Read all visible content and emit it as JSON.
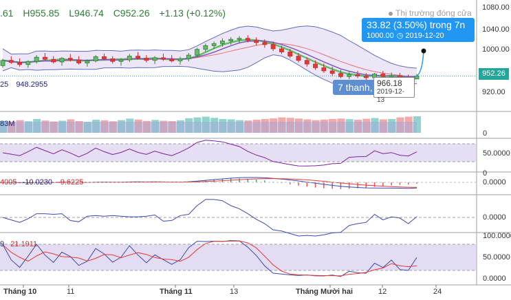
{
  "ohlc": {
    "open": ".61",
    "high": "H955.85",
    "low": "L946.74",
    "close": "C952.26",
    "change": "+1.13 (+0.12%)"
  },
  "market_status": "Thị trường đóng cửa",
  "bb_values": {
    "a": "25",
    "b": "948.2955"
  },
  "volume_value": "83M",
  "macd_values": {
    "a": "4005",
    "b": "-10.0230",
    "c": "-9.6225"
  },
  "stoch_values": {
    "a": "9",
    "b": "21.1911"
  },
  "measure": {
    "change": "33.82 (3.50%) trong 7n",
    "price": "1000.00",
    "date": "2019-12-20"
  },
  "low_label": {
    "text": "7 thanh,",
    "value": "966.18",
    "date": "2019-12-13"
  },
  "current_price": "952.26",
  "price_axis": [
    "1080.00",
    "1040.00",
    "1000.00",
    "920.00"
  ],
  "volume_axis": "0",
  "rsi_axis": [
    "50.0000",
    "0"
  ],
  "macd_axis": "0.0000",
  "mom_axis": "0.0000",
  "stoch_axis": [
    "100.0000",
    "50.0000",
    "0.0000"
  ],
  "x_axis": [
    {
      "label": "Tháng 10",
      "bold": true
    },
    {
      "label": "11",
      "bold": false
    },
    {
      "label": "Tháng 11",
      "bold": true
    },
    {
      "label": "13",
      "bold": false
    },
    {
      "label": "Tháng Mười hai",
      "bold": true
    },
    {
      "label": "12",
      "bold": false
    },
    {
      "label": "24",
      "bold": false
    }
  ],
  "colors": {
    "up": "#26a69a",
    "down": "#ef5350",
    "accent": "#2196f3",
    "band": "#7e57c2"
  },
  "chart_data": {
    "type": "candlestick",
    "ohlc_series": [
      [
        972,
        985,
        968,
        982
      ],
      [
        982,
        990,
        975,
        978
      ],
      [
        978,
        986,
        970,
        974
      ],
      [
        974,
        982,
        968,
        980
      ],
      [
        980,
        992,
        976,
        988
      ],
      [
        988,
        996,
        982,
        984
      ],
      [
        984,
        990,
        976,
        979
      ],
      [
        979,
        988,
        972,
        986
      ],
      [
        986,
        994,
        980,
        983
      ],
      [
        983,
        990,
        974,
        977
      ],
      [
        977,
        984,
        970,
        981
      ],
      [
        981,
        992,
        978,
        989
      ],
      [
        989,
        995,
        982,
        985
      ],
      [
        985,
        990,
        976,
        980
      ],
      [
        980,
        986,
        972,
        983
      ],
      [
        983,
        994,
        979,
        990
      ],
      [
        990,
        998,
        984,
        986
      ],
      [
        986,
        992,
        978,
        982
      ],
      [
        982,
        990,
        975,
        987
      ],
      [
        987,
        995,
        981,
        984
      ],
      [
        984,
        992,
        978,
        981
      ],
      [
        981,
        989,
        974,
        985
      ],
      [
        985,
        996,
        980,
        992
      ],
      [
        992,
        1006,
        988,
        1003
      ],
      [
        1003,
        1014,
        998,
        1010
      ],
      [
        1010,
        1018,
        1004,
        1014
      ],
      [
        1014,
        1024,
        1008,
        1019
      ],
      [
        1019,
        1026,
        1012,
        1022
      ],
      [
        1022,
        1028,
        1014,
        1024
      ],
      [
        1024,
        1030,
        1016,
        1020
      ],
      [
        1020,
        1026,
        1010,
        1016
      ],
      [
        1016,
        1022,
        1006,
        1012
      ],
      [
        1012,
        1018,
        1000,
        1004
      ],
      [
        1004,
        1010,
        994,
        998
      ],
      [
        998,
        1004,
        986,
        990
      ],
      [
        990,
        996,
        978,
        982
      ],
      [
        982,
        988,
        970,
        975
      ],
      [
        975,
        982,
        964,
        968
      ],
      [
        968,
        976,
        958,
        962
      ],
      [
        962,
        970,
        952,
        957
      ],
      [
        957,
        964,
        948,
        951
      ],
      [
        951,
        960,
        946,
        955
      ],
      [
        955,
        962,
        948,
        952
      ],
      [
        952,
        958,
        944,
        949
      ],
      [
        949,
        958,
        946,
        956
      ],
      [
        956,
        962,
        948,
        951
      ],
      [
        951,
        959,
        946,
        953
      ],
      [
        953,
        958,
        944,
        948
      ],
      [
        948,
        955,
        942,
        946
      ],
      [
        946.5,
        955.85,
        946.74,
        952.26
      ]
    ],
    "volume": [
      62,
      58,
      66,
      60,
      72,
      64,
      59,
      63,
      70,
      61,
      57,
      68,
      65,
      60,
      66,
      74,
      69,
      62,
      67,
      63,
      61,
      65,
      76,
      80,
      84,
      78,
      72,
      70,
      66,
      64,
      68,
      72,
      75,
      80,
      78,
      74,
      70,
      66,
      69,
      72,
      74,
      71,
      68,
      73,
      77,
      70,
      72,
      80,
      84,
      86
    ]
  }
}
